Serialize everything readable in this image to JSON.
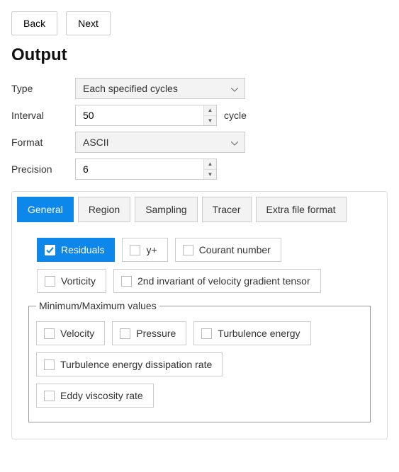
{
  "nav": {
    "back": "Back",
    "next": "Next"
  },
  "heading": "Output",
  "form": {
    "type_label": "Type",
    "type_value": "Each specified cycles",
    "interval_label": "Interval",
    "interval_value": "50",
    "interval_unit": "cycle",
    "format_label": "Format",
    "format_value": "ASCII",
    "precision_label": "Precision",
    "precision_value": "6"
  },
  "tabs": {
    "general": "General",
    "region": "Region",
    "sampling": "Sampling",
    "tracer": "Tracer",
    "extra": "Extra file format"
  },
  "checks": {
    "residuals": "Residuals",
    "yplus": "y+",
    "courant": "Courant number",
    "vorticity": "Vorticity",
    "second_inv": "2nd invariant of velocity gradient tensor"
  },
  "minmax": {
    "legend": "Minimum/Maximum values",
    "velocity": "Velocity",
    "pressure": "Pressure",
    "turb_energy": "Turbulence energy",
    "turb_diss": "Turbulence energy dissipation rate",
    "eddy_visc": "Eddy viscosity rate"
  }
}
